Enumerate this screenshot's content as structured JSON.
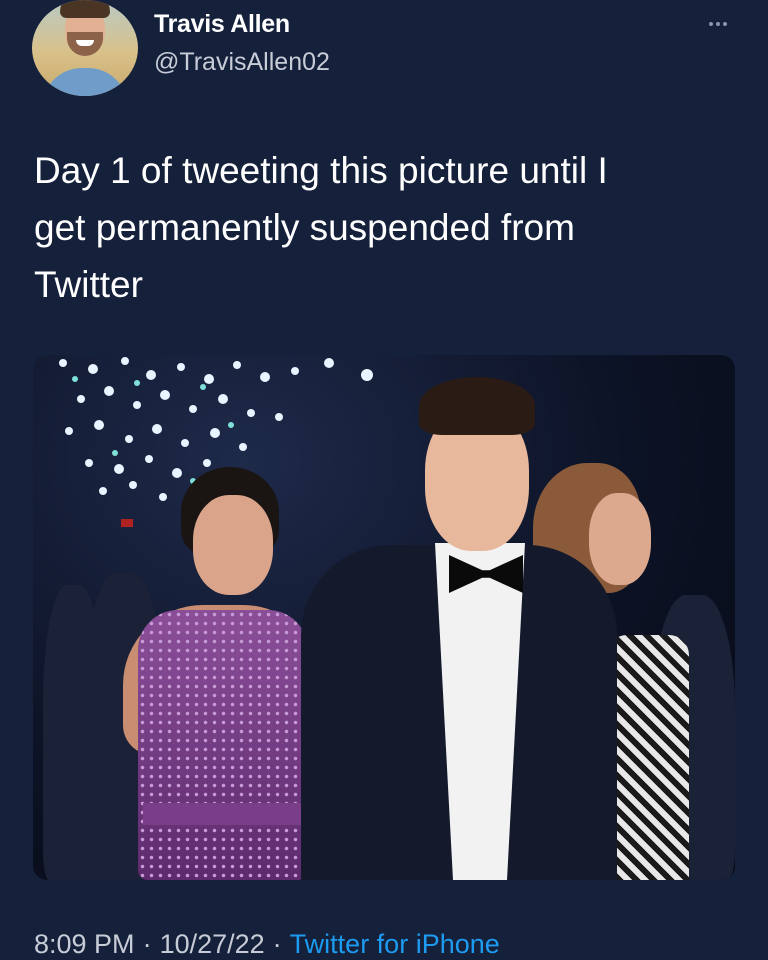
{
  "tweet": {
    "author": {
      "display_name": "Travis Allen",
      "handle": "@TravisAllen02",
      "avatar_icon": "profile-photo"
    },
    "text": "Day 1 of tweeting this picture until I\nget permanently suspended from\nTwitter",
    "more_icon": "ellipsis-icon",
    "footer": {
      "time": "8:09 PM",
      "separator": "·",
      "date": "10/27/22",
      "source": "Twitter for iPhone"
    }
  },
  "colors": {
    "background": "#15203b",
    "text": "#ffffff",
    "secondary_text": "#c7ccd6",
    "link": "#1d9bf0"
  }
}
